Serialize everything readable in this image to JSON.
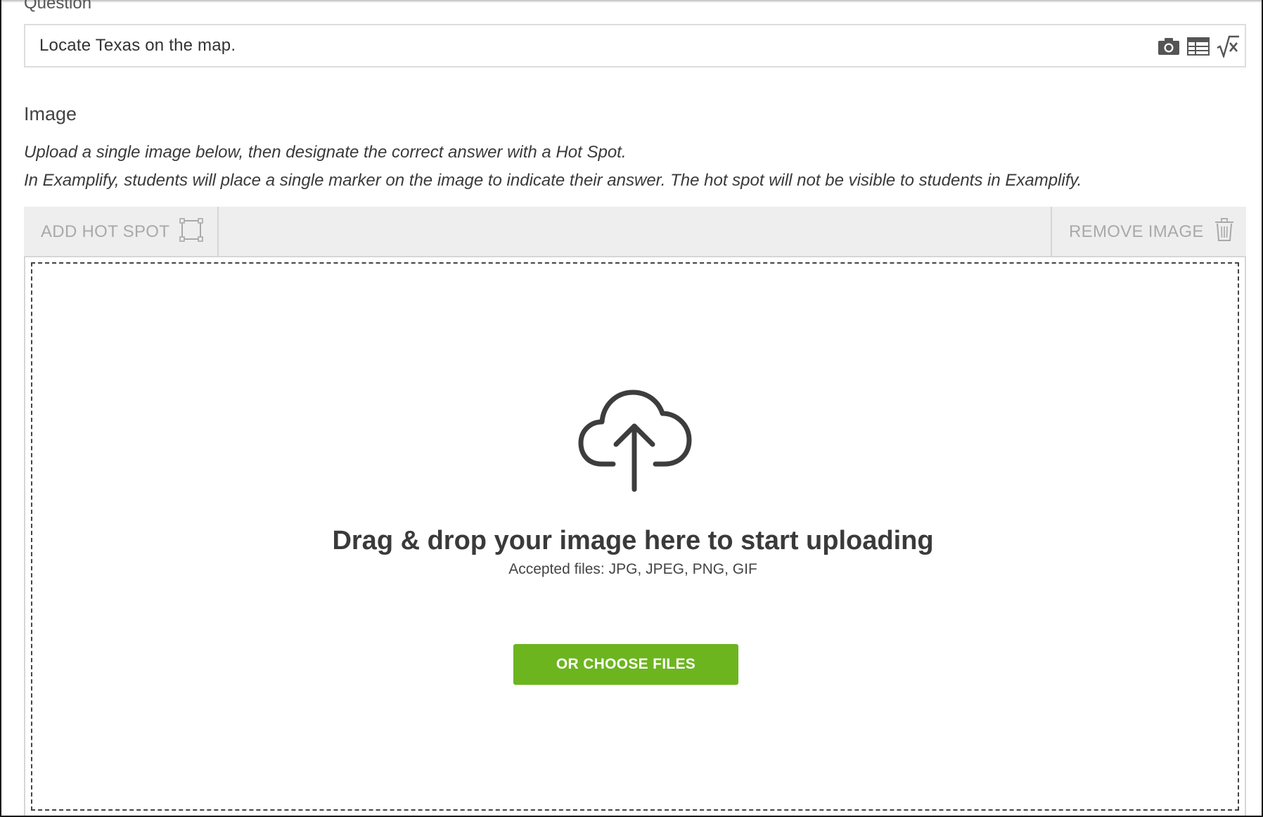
{
  "question": {
    "label": "Question",
    "value": "Locate Texas on the map.",
    "tools": [
      {
        "name": "camera-icon"
      },
      {
        "name": "table-icon"
      },
      {
        "name": "square-root-icon"
      }
    ]
  },
  "image_section": {
    "label": "Image",
    "instructions": [
      "Upload a single image below, then designate the correct answer with a Hot Spot.",
      "In Examplify, students will place a single marker on the image to indicate their answer. The hot spot will not be visible to students in Examplify."
    ]
  },
  "toolbar": {
    "add_hot_spot_label": "ADD HOT SPOT",
    "remove_image_label": "REMOVE IMAGE"
  },
  "dropzone": {
    "title": "Drag & drop your image here to start uploading",
    "accepted": "Accepted files: JPG, JPEG, PNG, GIF",
    "choose_label": "OR CHOOSE FILES"
  },
  "colors": {
    "accent_green": "#6cb51f",
    "toolbar_bg": "#eeeeee",
    "disabled_text": "#a9a9a9"
  }
}
